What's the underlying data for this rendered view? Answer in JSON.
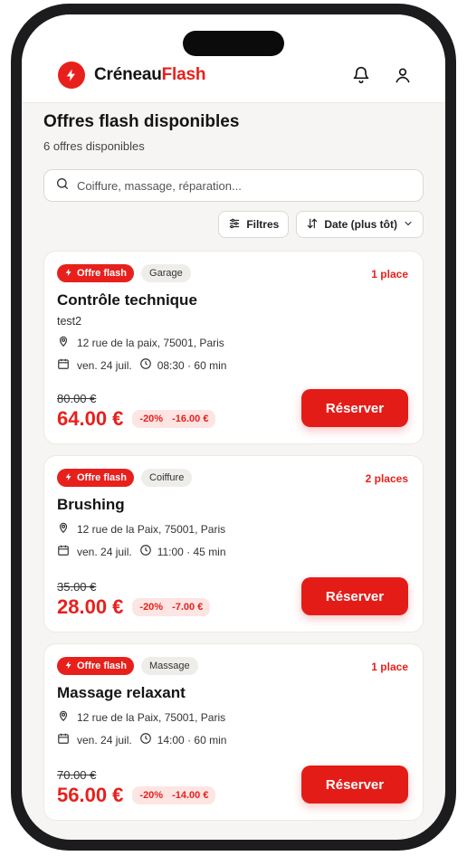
{
  "app": {
    "brand_prefix": "Créneau",
    "brand_suffix": "Flash"
  },
  "header": {
    "bell_icon": "bell-icon",
    "user_icon": "user-icon"
  },
  "page": {
    "title": "Offres flash disponibles",
    "subtitle": "6 offres disponibles"
  },
  "search": {
    "placeholder": "Coiffure, massage, réparation..."
  },
  "controls": {
    "filters_label": "Filtres",
    "sort_label": "Date (plus tôt)"
  },
  "offers": [
    {
      "flash_label": "Offre flash",
      "category": "Garage",
      "places": "1 place",
      "title": "Contrôle technique",
      "desc": "test2",
      "address": "12 rue de la paix, 75001, Paris",
      "date": "ven. 24 juil.",
      "time": "08:30 · 60 min",
      "old_price": "80.00 €",
      "new_price": "64.00 €",
      "discount_pct": "-20%",
      "discount_amount": "-16.00 €",
      "cta": "Réserver"
    },
    {
      "flash_label": "Offre flash",
      "category": "Coiffure",
      "places": "2 places",
      "title": "Brushing",
      "address": "12 rue de la Paix, 75001, Paris",
      "date": "ven. 24 juil.",
      "time": "11:00 · 45 min",
      "old_price": "35.00 €",
      "new_price": "28.00 €",
      "discount_pct": "-20%",
      "discount_amount": "-7.00 €",
      "cta": "Réserver"
    },
    {
      "flash_label": "Offre flash",
      "category": "Massage",
      "places": "1 place",
      "title": "Massage relaxant",
      "address": "12 rue de la Paix, 75001, Paris",
      "date": "ven. 24 juil.",
      "time": "14:00 · 60 min",
      "old_price": "70.00 €",
      "new_price": "56.00 €",
      "discount_pct": "-20%",
      "discount_amount": "-14.00 €",
      "cta": "Réserver"
    }
  ],
  "colors": {
    "accent": "#e8201c",
    "background": "#f6f5f3"
  }
}
